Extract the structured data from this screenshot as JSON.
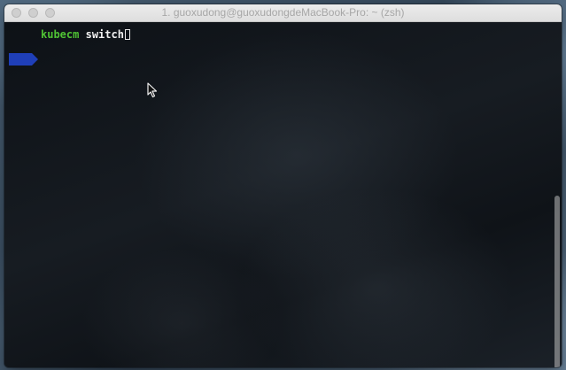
{
  "window": {
    "title": "1. guoxudong@guoxudongdeMacBook-Pro: ~ (zsh)"
  },
  "terminal": {
    "prompt_segment_color": "#1f3fb8",
    "command": "kubecm",
    "argument": "switch",
    "command_color": "#4fc234",
    "argument_color": "#f0f0f0"
  },
  "icons": {
    "close": "close-button",
    "minimize": "minimize-button",
    "zoom": "zoom-button",
    "prompt": "prompt-segment-arrow",
    "cursor": "arrow-pointer-icon"
  }
}
